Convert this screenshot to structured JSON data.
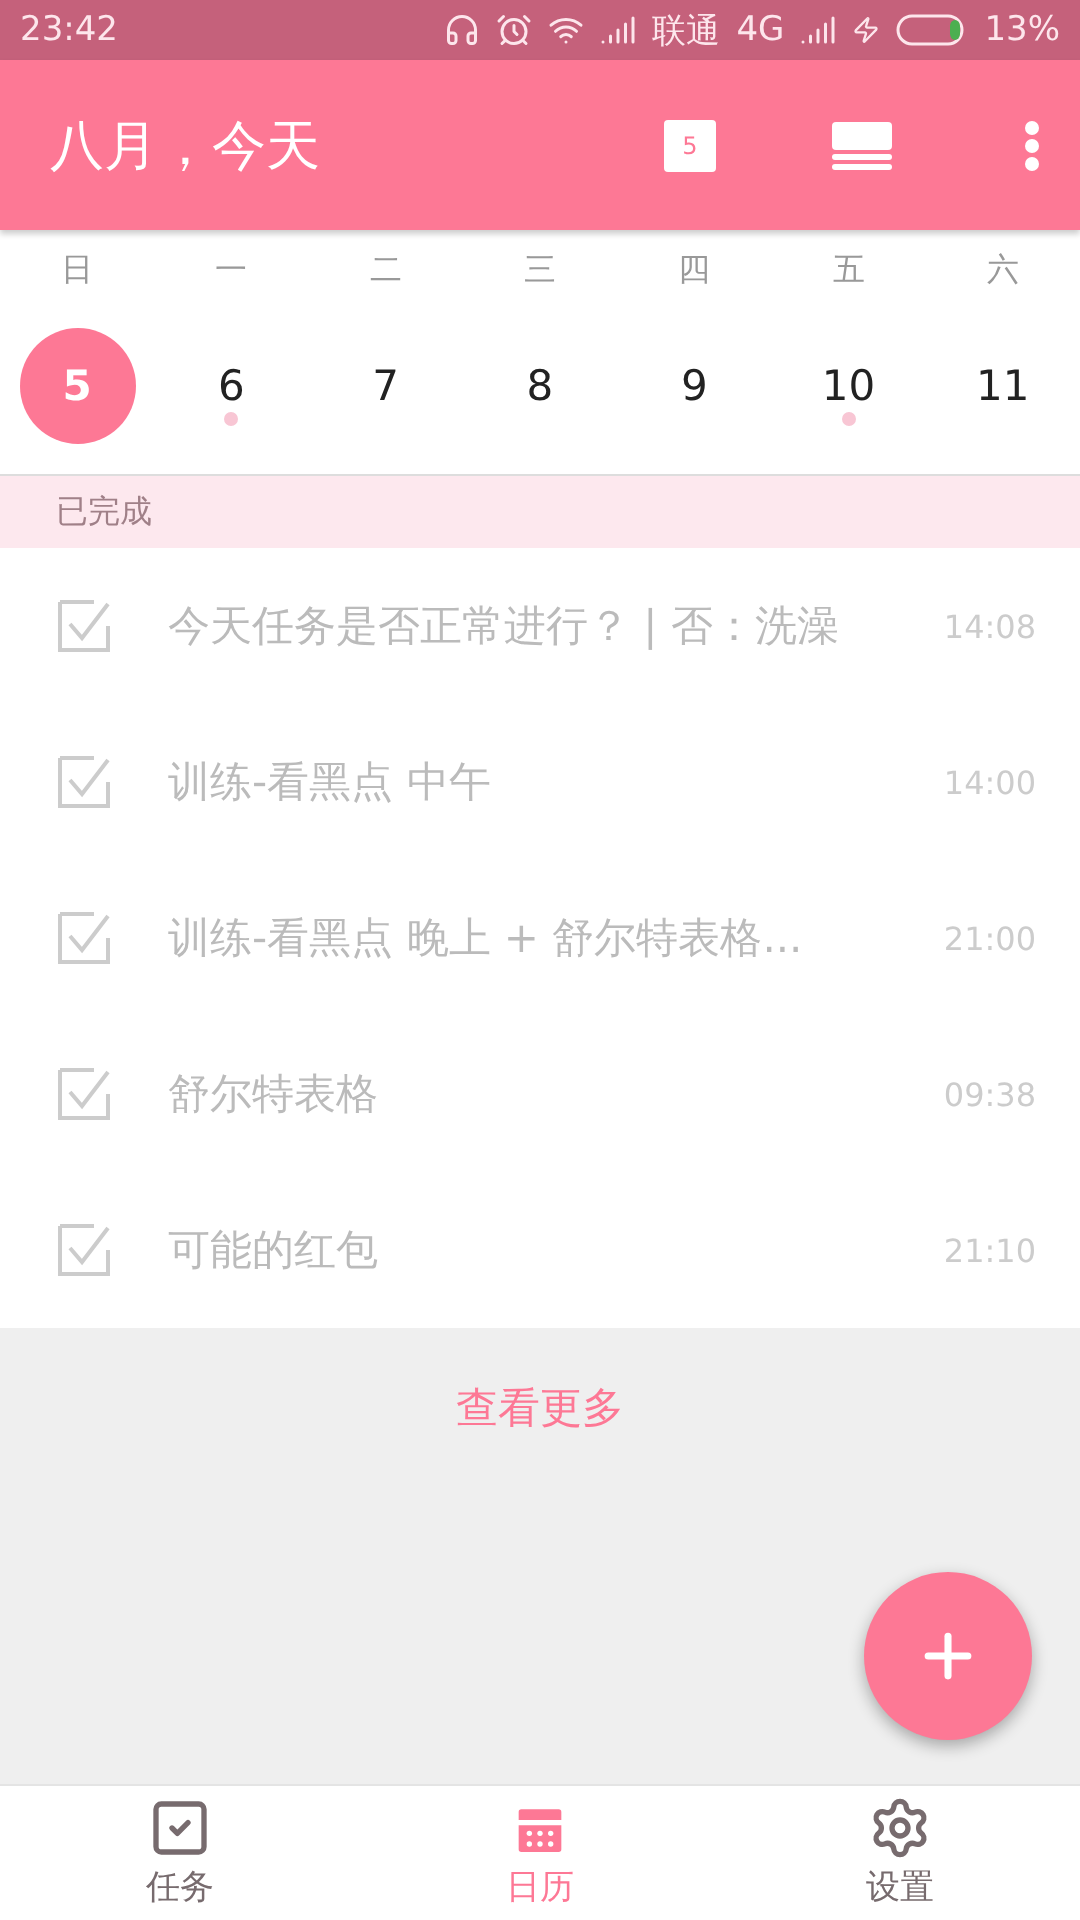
{
  "status_bar": {
    "time": "23:42",
    "carrier": "联通",
    "network": "4G",
    "battery": "13%"
  },
  "app_bar": {
    "title": "八月，今天",
    "calendar_day": "5"
  },
  "weekdays": [
    "日",
    "一",
    "二",
    "三",
    "四",
    "五",
    "六"
  ],
  "dates": [
    {
      "day": "5",
      "selected": true,
      "has_dot": false
    },
    {
      "day": "6",
      "selected": false,
      "has_dot": true
    },
    {
      "day": "7",
      "selected": false,
      "has_dot": false
    },
    {
      "day": "8",
      "selected": false,
      "has_dot": false
    },
    {
      "day": "9",
      "selected": false,
      "has_dot": false
    },
    {
      "day": "10",
      "selected": false,
      "has_dot": true
    },
    {
      "day": "11",
      "selected": false,
      "has_dot": false
    }
  ],
  "section": {
    "title": "已完成"
  },
  "tasks": [
    {
      "title": "今天任务是否正常进行？ | 否：洗澡",
      "time": "14:08",
      "checked": true
    },
    {
      "title": "训练-看黑点  中午",
      "time": "14:00",
      "checked": true
    },
    {
      "title": "训练-看黑点  晚上  +  舒尔特表格...",
      "time": "21:00",
      "checked": true
    },
    {
      "title": "舒尔特表格",
      "time": "09:38",
      "checked": true
    },
    {
      "title": "可能的红包",
      "time": "21:10",
      "checked": true
    }
  ],
  "more_link": "查看更多",
  "bottom_nav": [
    {
      "label": "任务",
      "kind": "tasks",
      "selected": false
    },
    {
      "label": "日历",
      "kind": "calendar",
      "selected": true
    },
    {
      "label": "设置",
      "kind": "settings",
      "selected": false
    }
  ]
}
